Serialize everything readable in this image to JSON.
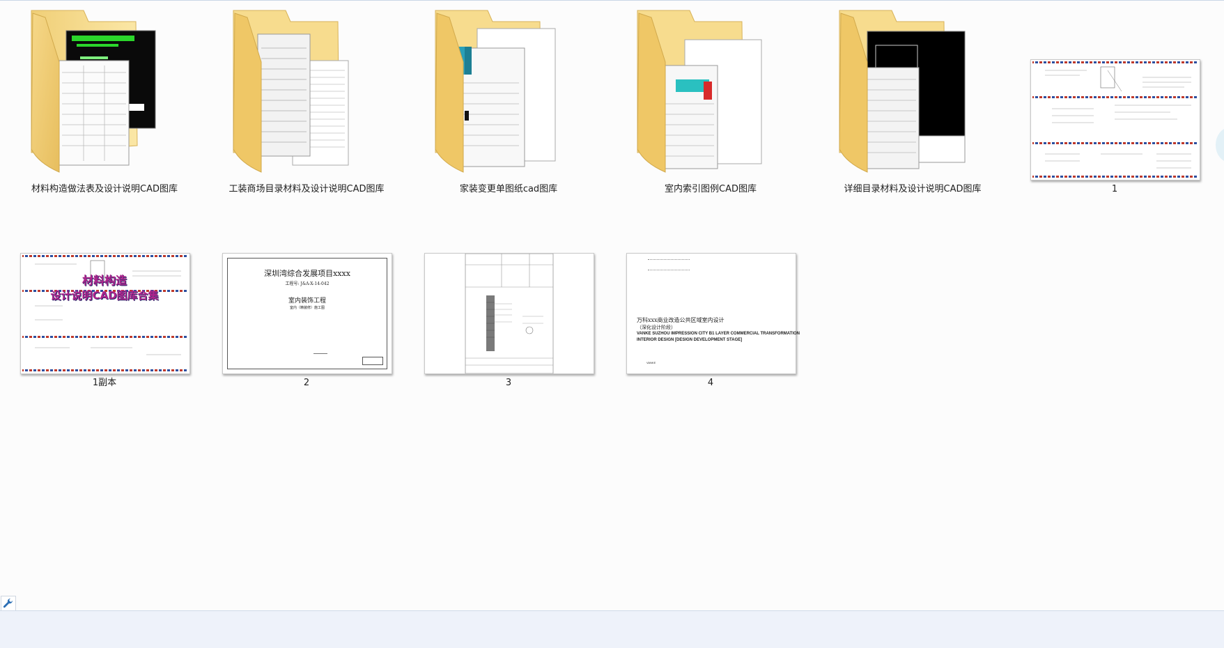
{
  "items": [
    {
      "type": "folder",
      "label": "材料构造做法表及设计说明CAD图库",
      "preview": "dark"
    },
    {
      "type": "folder",
      "label": "工装商场目录材料及设计说明CAD图库",
      "preview": "sheets"
    },
    {
      "type": "folder",
      "label": "家装变更单图纸cad图库",
      "preview": "forms"
    },
    {
      "type": "folder",
      "label": "室内索引图例CAD图库",
      "preview": "index"
    },
    {
      "type": "folder",
      "label": "详细目录材料及设计说明CAD图库",
      "preview": "black"
    },
    {
      "type": "file",
      "label": "1",
      "preview": "airmail"
    },
    {
      "type": "file",
      "label": "1副本",
      "preview": "airmail-titled"
    },
    {
      "type": "file",
      "label": "2",
      "preview": "cover"
    },
    {
      "type": "file",
      "label": "3",
      "preview": "drawing"
    },
    {
      "type": "file",
      "label": "4",
      "preview": "english"
    }
  ],
  "thumb_text": {
    "folder1_title": "材料构造做法表及设计说明",
    "copy_line1": "材料构造",
    "copy_line2": "设计说明CAD图库合集",
    "cover_title": "深圳湾综合发展项目xxxx",
    "cover_no": "工程号: J&A-X-14-042",
    "cover_sub": "室内装饰工程",
    "cover_sub2": "室内（精装修）施工图",
    "eng_line1": "万科xxx商业改造公共区域室内设计",
    "eng_line2": "（深化设计阶段）",
    "eng_line3": "VANKE SUZHOU IMPRESSION CITY B1 LAYER COMMERCIAL TRANSFORMATION",
    "eng_line4": "INTERIOR DESIGN [DESIGN DEVELOPMENT STAGE]",
    "eng_logo": "VANKE"
  }
}
